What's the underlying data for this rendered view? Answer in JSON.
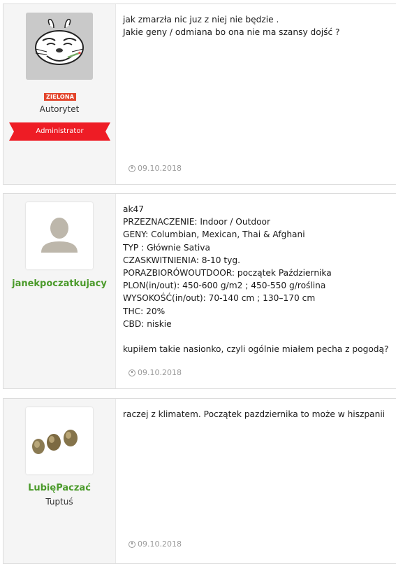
{
  "posts": [
    {
      "user": {
        "badge": "ZIELONA",
        "title": "Autorytet",
        "role": "Administrator"
      },
      "message": "jak zmarzła nic juz z niej nie będzie .\nJakie geny / odmiana bo ona nie ma szansy dojść ?",
      "date": "09.10.2018"
    },
    {
      "user": {
        "name": "janekpoczatkujacy"
      },
      "message": "ak47\nPRZEZNACZENIE: Indoor / Outdoor\nGENY: Columbian, Mexican, Thai & Afghani\nTYP : Głównie Sativa\nCZASKWITNIENIA: 8-10 tyg.\nPORAZBIORÓWOUTDOOR: początek Października\nPLON(in/out): 450-600 g/m2 ; 450-550 g/roślina\nWYSOKOŚĆ(in/out): 70-140 cm ; 130–170 cm\nTHC: 20%\nCBD: niskie\n\nkupiłem takie nasionko, czyli ogólnie miałem pecha z pogodą?",
      "date": "09.10.2018"
    },
    {
      "user": {
        "name": "LubięPaczać",
        "title": "Tuptuś"
      },
      "message": "raczej z klimatem. Początek pazdziernika to może w hiszpanii",
      "date": "09.10.2018"
    }
  ],
  "colors": {
    "username": "#4a9a2a",
    "ribbon": "#ee1c25",
    "badge": "#e3452c"
  },
  "icons": {
    "date": "clock-icon",
    "avatar_placeholder": "user-silhouette-icon"
  }
}
